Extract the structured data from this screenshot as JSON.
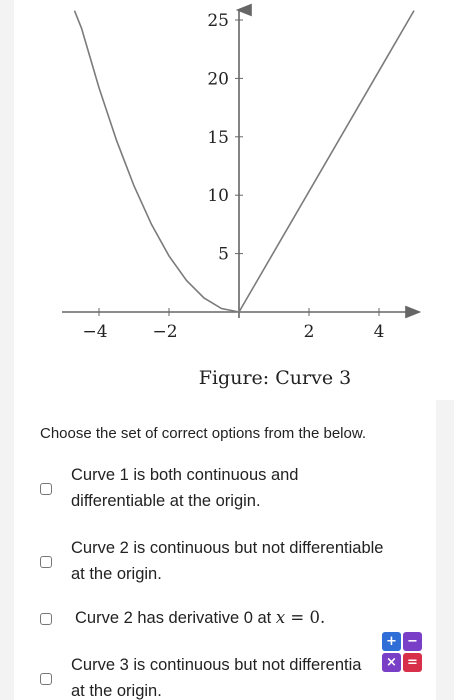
{
  "figure": {
    "caption": "Figure: Curve 3",
    "x_tick_labels": [
      "−4",
      "−2",
      "2",
      "4"
    ],
    "y_tick_labels": [
      "5",
      "10",
      "15",
      "20",
      "25"
    ]
  },
  "chart_data": {
    "type": "line",
    "x_ticks": [
      -4,
      -2,
      2,
      4
    ],
    "y_ticks": [
      5,
      10,
      15,
      20,
      25
    ],
    "xlim": [
      -5.0,
      5.2
    ],
    "ylim": [
      -1.2,
      26.5
    ],
    "series": [
      {
        "x": [
          -4.7,
          -4.5,
          -4.0,
          -3.5,
          -3.0,
          -2.5,
          -2.0,
          -1.5,
          -1.0,
          -0.5,
          0
        ],
        "y": [
          25.8,
          24.3,
          19.2,
          14.7,
          10.8,
          7.5,
          4.8,
          2.7,
          1.2,
          0.3,
          0
        ]
      },
      {
        "x": [
          0,
          5.0
        ],
        "y": [
          0,
          25.8
        ]
      }
    ],
    "grid": false,
    "colors": {
      "curve": "#7b7b7b",
      "axis": "#666666"
    }
  },
  "question": {
    "prompt": "Choose the set of correct options from the below.",
    "options": [
      {
        "lines": [
          "Curve 1 is both continuous and",
          "differentiable at the origin."
        ]
      },
      {
        "lines": [
          "Curve 2 is continuous but not differentiable",
          "at the origin."
        ]
      },
      {
        "prefix": "Curve 2 has derivative 0 at ",
        "math_var": "x",
        "math_rest": " = 0."
      },
      {
        "lines": [
          "Curve 3 is continuous but not differentia",
          "at the origin."
        ]
      }
    ]
  },
  "calculator": {
    "keys": [
      "+",
      "−",
      "×",
      "="
    ],
    "colors": {
      "plus": "#2e6ed6",
      "minus": "#7a3fc7",
      "times": "#7a3fc7",
      "equals": "#d8304a"
    }
  }
}
